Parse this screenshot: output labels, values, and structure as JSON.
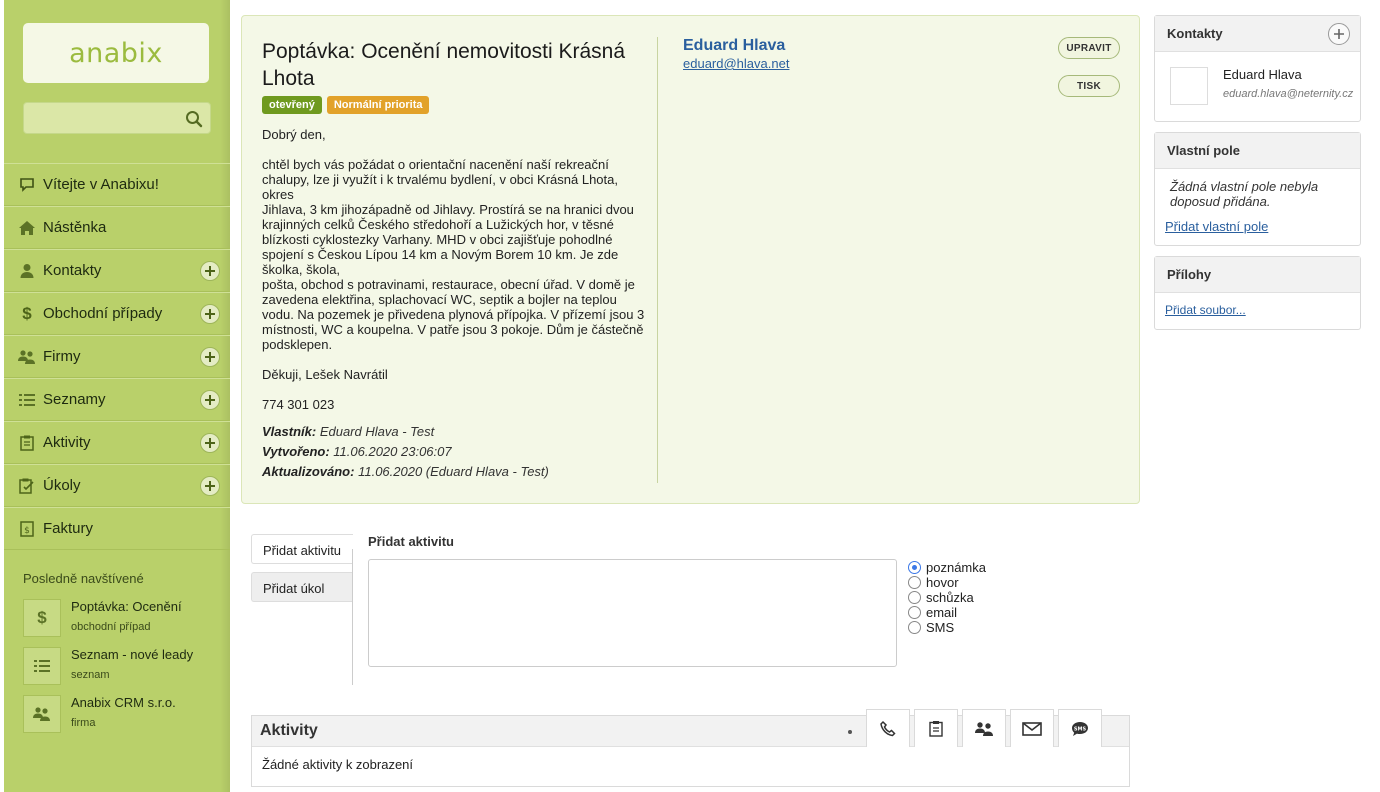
{
  "sidebar": {
    "logo": "anabix",
    "search": {
      "value": "",
      "placeholder": ""
    },
    "nav": [
      {
        "label": "Vítejte v Anabixu!",
        "icon": "speech-bubble-icon",
        "has_add": false
      },
      {
        "label": "Nástěnka",
        "icon": "home-icon",
        "has_add": false
      },
      {
        "label": "Kontakty",
        "icon": "person-icon",
        "has_add": true
      },
      {
        "label": "Obchodní případy",
        "icon": "dollar-icon",
        "has_add": true
      },
      {
        "label": "Firmy",
        "icon": "group-icon",
        "has_add": true
      },
      {
        "label": "Seznamy",
        "icon": "list-icon",
        "has_add": true
      },
      {
        "label": "Aktivity",
        "icon": "clipboard-icon",
        "has_add": true
      },
      {
        "label": "Úkoly",
        "icon": "checklist-icon",
        "has_add": true
      },
      {
        "label": "Faktury",
        "icon": "invoice-icon",
        "has_add": false
      }
    ],
    "recent_title": "Posledně navštívené",
    "recent": [
      {
        "name": "Poptávka: Ocenění",
        "type": "obchodní případ",
        "icon": "dollar-icon"
      },
      {
        "name": "Seznam - nové leady",
        "type": "seznam",
        "icon": "list-icon"
      },
      {
        "name": "Anabix CRM s.r.o.",
        "type": "firma",
        "icon": "group-icon"
      }
    ]
  },
  "deal": {
    "title": "Poptávka: Ocenění nemovitosti Krásná Lhota",
    "status_badge": "otevřený",
    "priority_badge": "Normální priorita",
    "body": [
      "Dobrý den,",
      "chtěl bych vás požádat o orientační nacenění naší rekreační chalupy, lze ji využít i k trvalému bydlení, v obci Krásná Lhota, okres\nJihlava, 3 km jihozápadně od Jihlavy. Prostírá se na hranici dvou krajinných celků Českého středohoří a Lužických hor, v těsné blízkosti cyklostezky Varhany. MHD v obci zajišťuje pohodlné spojení s Českou Lípou 14 km a Novým Borem 10 km. Je zde školka, škola,\npošta, obchod s potravinami, restaurace, obecní úřad. V domě je zavedena elektřina, splachovací WC, septik a bojler na teplou vodu. Na pozemek je přivedena plynová přípojka. V přízemí jsou 3 místnosti, WC a koupelna. V patře jsou 3 pokoje. Dům je částečně podsklepen.",
      "Děkuji, Lešek Navrátil",
      "774 301 023"
    ],
    "owner_label": "Vlastník:",
    "owner_value": "Eduard Hlava - Test",
    "created_label": "Vytvořeno:",
    "created_value": "11.06.2020 23:06:07",
    "updated_label": "Aktualizováno:",
    "updated_value": "11.06.2020 (Eduard Hlava - Test)",
    "contact_name": "Eduard Hlava",
    "contact_email": "eduard@hlava.net",
    "edit_button": "UPRAVIT",
    "print_button": "TISK"
  },
  "panels": {
    "contacts_title": "Kontakty",
    "contact_name": "Eduard Hlava",
    "contact_email": "eduard.hlava@neternity.cz",
    "custom_title": "Vlastní pole",
    "custom_empty": "Žádná vlastní pole nebyla doposud přidána.",
    "custom_link": "Přidat vlastní pole",
    "attachments_title": "Přílohy",
    "attachments_link": "Přidat soubor..."
  },
  "activity_form": {
    "tab_activity": "Přidat aktivitu",
    "tab_task": "Přidat úkol",
    "title": "Přidat aktivitu",
    "textarea_value": "",
    "types": [
      "poznámka",
      "hovor",
      "schůzka",
      "email",
      "SMS"
    ],
    "selected_type": "poznámka"
  },
  "activities": {
    "title": "Aktivity",
    "empty": "Žádné aktivity k zobrazení",
    "filter_icons": [
      "phone-icon",
      "clipboard-icon",
      "meeting-icon",
      "envelope-icon",
      "sms-icon"
    ]
  },
  "colors": {
    "sidebar_green": "#b9d06a",
    "badge_open": "#6f9a1f",
    "badge_priority": "#e2a22a",
    "link_blue": "#2a5f9e",
    "card_bg": "#f4f8e7"
  }
}
